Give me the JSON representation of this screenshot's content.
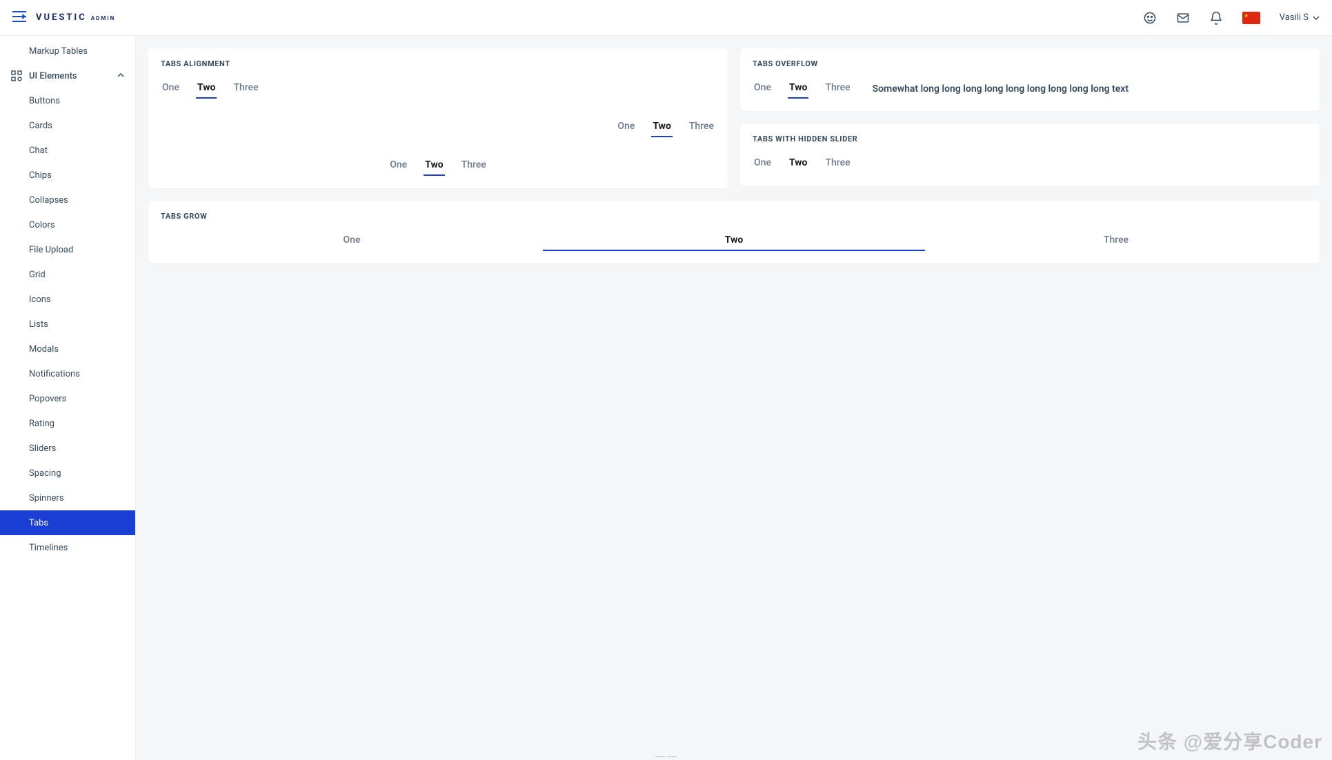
{
  "brand": {
    "name": "VUESTIC",
    "suffix": "ADMIN"
  },
  "topbar": {
    "user": "Vasili S"
  },
  "sidebar": {
    "markup_tables": "Markup Tables",
    "group_label": "UI Elements",
    "items": {
      "buttons": "Buttons",
      "cards": "Cards",
      "chat": "Chat",
      "chips": "Chips",
      "collapses": "Collapses",
      "colors": "Colors",
      "file_upload": "File Upload",
      "grid": "Grid",
      "icons": "Icons",
      "lists": "Lists",
      "modals": "Modals",
      "notifications": "Notifications",
      "popovers": "Popovers",
      "rating": "Rating",
      "sliders": "Sliders",
      "spacing": "Spacing",
      "spinners": "Spinners",
      "tabs": "Tabs",
      "timelines": "Timelines"
    }
  },
  "cards": {
    "alignment": {
      "title": "TABS ALIGNMENT",
      "tabs": {
        "one": "One",
        "two": "Two",
        "three": "Three"
      }
    },
    "overflow": {
      "title": "TABS OVERFLOW",
      "tabs": {
        "one": "One",
        "two": "Two",
        "three": "Three"
      },
      "extra": "Somewhat long long long long long long long long long text"
    },
    "hidden": {
      "title": "TABS WITH HIDDEN SLIDER",
      "tabs": {
        "one": "One",
        "two": "Two",
        "three": "Three"
      }
    },
    "grow": {
      "title": "TABS GROW",
      "tabs": {
        "one": "One",
        "two": "Two",
        "three": "Three"
      }
    }
  },
  "watermark": "头条 @爱分享Coder"
}
